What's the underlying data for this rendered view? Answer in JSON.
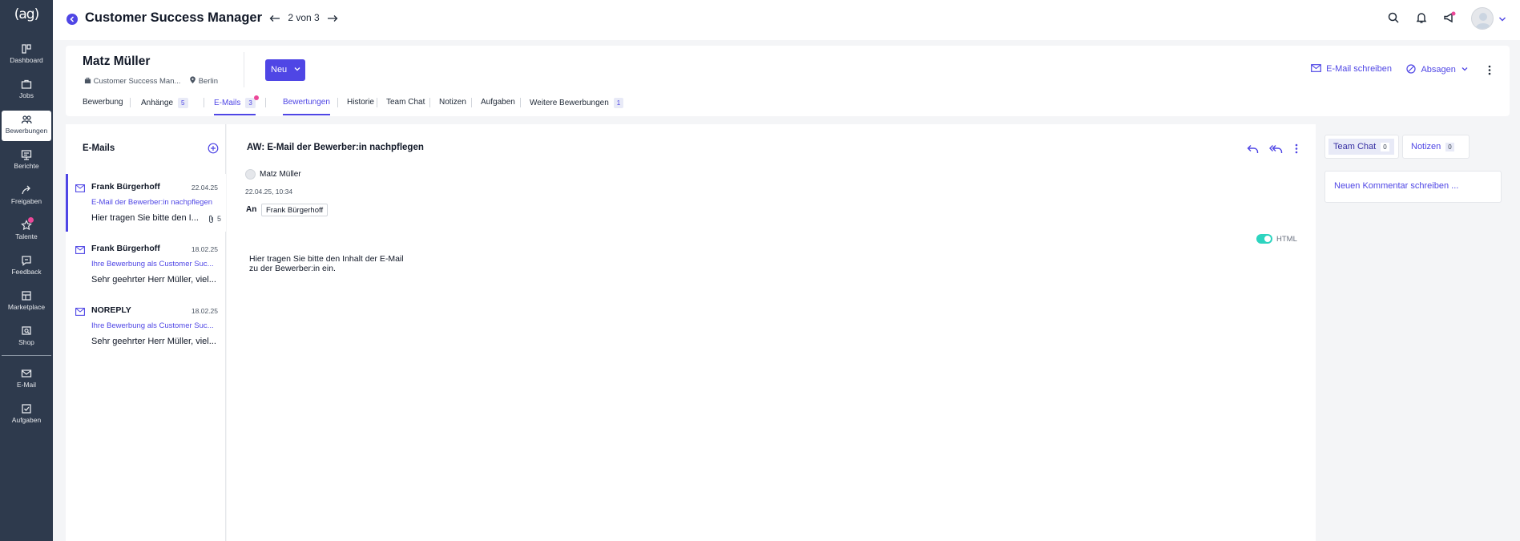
{
  "sidebar": {
    "logo": "(ag)",
    "items": [
      {
        "label": "Dashboard",
        "icon": "dashboard-icon"
      },
      {
        "label": "Jobs",
        "icon": "briefcase-icon"
      },
      {
        "label": "Bewerbungen",
        "icon": "people-icon",
        "active": true
      },
      {
        "label": "Berichte",
        "icon": "report-icon"
      },
      {
        "label": "Freigaben",
        "icon": "share-icon"
      },
      {
        "label": "Talente",
        "icon": "star-icon",
        "notification": true
      },
      {
        "label": "Feedback",
        "icon": "chat-icon"
      },
      {
        "label": "Marketplace",
        "icon": "store-icon"
      },
      {
        "label": "Shop",
        "icon": "shop-icon"
      },
      {
        "label": "E-Mail",
        "icon": "mail-icon"
      },
      {
        "label": "Aufgaben",
        "icon": "task-icon"
      }
    ]
  },
  "topbar": {
    "title": "Customer Success Manager",
    "pager": "2 von 3",
    "icons": [
      "back-icon",
      "arrow-left-icon",
      "arrow-right-icon",
      "search-icon",
      "bell-icon",
      "megaphone-icon",
      "avatar",
      "chevron-down-icon"
    ]
  },
  "candidate": {
    "name": "Matz Müller",
    "job": "Customer Success Man...",
    "location": "Berlin",
    "new_button": "Neu",
    "email_action": "E-Mail schreiben",
    "decline_action": "Absagen"
  },
  "tabs": [
    {
      "label": "Bewerbung"
    },
    {
      "label": "Anhänge",
      "count": "5"
    },
    {
      "label": "E-Mails",
      "count": "3",
      "active": true
    },
    {
      "label": "Bewertungen",
      "underlined": true
    },
    {
      "label": "Historie"
    },
    {
      "label": "Team Chat"
    },
    {
      "label": "Notizen"
    },
    {
      "label": "Aufgaben"
    },
    {
      "label": "Weitere Bewerbungen",
      "count": "1"
    }
  ],
  "mail_list": {
    "title": "E-Mails",
    "items": [
      {
        "from": "Frank Bürgerhoff",
        "date": "22.04.25",
        "subject": "E-Mail der Bewerber:in nachpflegen",
        "preview": "Hier tragen Sie bitte den I...",
        "attachments": "5",
        "active": true
      },
      {
        "from": "Frank Bürgerhoff",
        "date": "18.02.25",
        "subject": "Ihre Bewerbung als Customer Suc...",
        "preview": "Sehr geehrter Herr Müller, viel..."
      },
      {
        "from": "NOREPLY",
        "date": "18.02.25",
        "subject": "Ihre Bewerbung als Customer Suc...",
        "preview": "Sehr geehrter Herr Müller, viel..."
      }
    ]
  },
  "mail": {
    "subject": "AW: E-Mail der Bewerber:in nachpflegen",
    "sender": "Matz Müller",
    "datetime": "22.04.25, 10:34",
    "to_label": "An",
    "to": "Frank Bürgerhoff",
    "html_label": "HTML",
    "body": "Hier tragen Sie bitte den Inhalt der E-Mail zu der Bewerber:in ein."
  },
  "right_panel": {
    "tabs": [
      {
        "label": "Team Chat",
        "count": "0"
      },
      {
        "label": "Notizen",
        "count": "0"
      }
    ],
    "comment_placeholder": "Neuen Kommentar schreiben ..."
  },
  "colors": {
    "accent": "#4f46e5",
    "sidebar": "#2e3a4d",
    "notification": "#ec4899",
    "toggle": "#2dd4bf"
  }
}
